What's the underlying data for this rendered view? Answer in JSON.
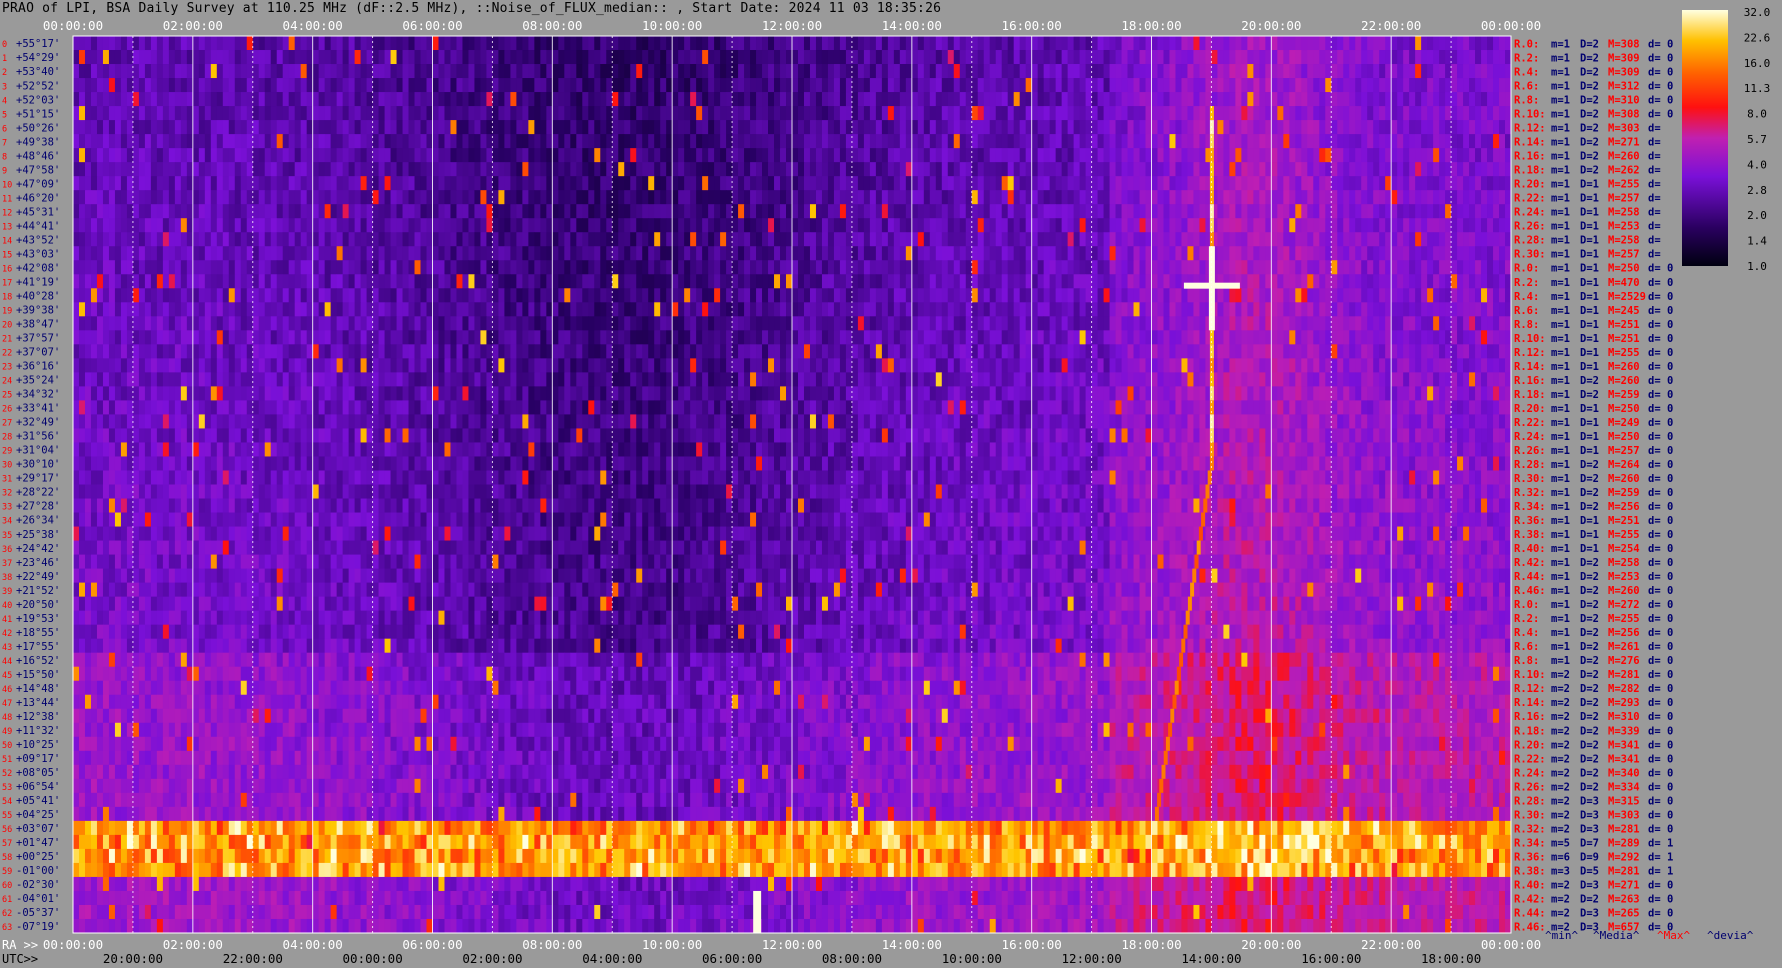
{
  "title": "PRAO of LPI, BSA Daily Survey at 110.25 MHz (dF::2.5 MHz), ::Noise_of_FLUX_median:: , Start Date: 2024 11 03 18:35:26",
  "chart_data": {
    "type": "heatmap",
    "top_time_labels": [
      "00:00:00",
      "02:00:00",
      "04:00:00",
      "06:00:00",
      "08:00:00",
      "10:00:00",
      "12:00:00",
      "14:00:00",
      "16:00:00",
      "18:00:00",
      "20:00:00",
      "22:00:00",
      "00:00:00"
    ],
    "bottom_ra_labels": [
      "00:00:00",
      "02:00:00",
      "04:00:00",
      "06:00:00",
      "08:00:00",
      "10:00:00",
      "12:00:00",
      "14:00:00",
      "16:00:00",
      "18:00:00",
      "20:00:00",
      "22:00:00",
      "00:00:00"
    ],
    "bottom_utc_labels": [
      "20:00:00",
      "22:00:00",
      "00:00:00",
      "02:00:00",
      "04:00:00",
      "06:00:00",
      "08:00:00",
      "10:00:00",
      "12:00:00",
      "14:00:00",
      "16:00:00",
      "18:00:00"
    ],
    "ra_prefix": "RA >>",
    "utc_prefix": "UTC>>",
    "colorbar_ticks": [
      "32.0",
      "22.6",
      "16.0",
      "11.3",
      "8.0",
      "5.7",
      "4.0",
      "2.8",
      "2.0",
      "1.4",
      "1.0"
    ],
    "legend_footer": [
      "^min^",
      "^Media^",
      "^Max^",
      "^devia^"
    ],
    "rows": [
      {
        "n": "0",
        "dec": "+55°17'",
        "r": "R.0:",
        "m": "1",
        "D": "2",
        "M": "308",
        "d": "0"
      },
      {
        "n": "1",
        "dec": "+54°29'",
        "r": "R.2:",
        "m": "1",
        "D": "2",
        "M": "309",
        "d": "0"
      },
      {
        "n": "2",
        "dec": "+53°40'",
        "r": "R.4:",
        "m": "1",
        "D": "2",
        "M": "309",
        "d": "0"
      },
      {
        "n": "3",
        "dec": "+52°52'",
        "r": "R.6:",
        "m": "1",
        "D": "2",
        "M": "312",
        "d": "0"
      },
      {
        "n": "4",
        "dec": "+52°03'",
        "r": "R.8:",
        "m": "1",
        "D": "2",
        "M": "310",
        "d": "0"
      },
      {
        "n": "5",
        "dec": "+51°15'",
        "r": "R.10:",
        "m": "1",
        "D": "2",
        "M": "308",
        "d": "0"
      },
      {
        "n": "6",
        "dec": "+50°26'",
        "r": "R.12:",
        "m": "1",
        "D": "2",
        "M": "303",
        "d": ""
      },
      {
        "n": "7",
        "dec": "+49°38'",
        "r": "R.14:",
        "m": "1",
        "D": "2",
        "M": "271",
        "d": ""
      },
      {
        "n": "8",
        "dec": "+48°46'",
        "r": "R.16:",
        "m": "1",
        "D": "2",
        "M": "260",
        "d": ""
      },
      {
        "n": "9",
        "dec": "+47°58'",
        "r": "R.18:",
        "m": "1",
        "D": "2",
        "M": "262",
        "d": ""
      },
      {
        "n": "10",
        "dec": "+47°09'",
        "r": "R.20:",
        "m": "1",
        "D": "1",
        "M": "255",
        "d": ""
      },
      {
        "n": "11",
        "dec": "+46°20'",
        "r": "R.22:",
        "m": "1",
        "D": "1",
        "M": "257",
        "d": ""
      },
      {
        "n": "12",
        "dec": "+45°31'",
        "r": "R.24:",
        "m": "1",
        "D": "1",
        "M": "258",
        "d": ""
      },
      {
        "n": "13",
        "dec": "+44°41'",
        "r": "R.26:",
        "m": "1",
        "D": "1",
        "M": "253",
        "d": ""
      },
      {
        "n": "14",
        "dec": "+43°52'",
        "r": "R.28:",
        "m": "1",
        "D": "1",
        "M": "258",
        "d": ""
      },
      {
        "n": "15",
        "dec": "+43°03'",
        "r": "R.30:",
        "m": "1",
        "D": "1",
        "M": "257",
        "d": ""
      },
      {
        "n": "16",
        "dec": "+42°08'",
        "r": "R.0:",
        "m": "1",
        "D": "1",
        "M": "250",
        "d": "0"
      },
      {
        "n": "17",
        "dec": "+41°19'",
        "r": "R.2:",
        "m": "1",
        "D": "1",
        "M": "470",
        "d": "0"
      },
      {
        "n": "18",
        "dec": "+40°28'",
        "r": "R.4:",
        "m": "1",
        "D": "1",
        "M": "2529",
        "d": "0"
      },
      {
        "n": "19",
        "dec": "+39°38'",
        "r": "R.6:",
        "m": "1",
        "D": "1",
        "M": "245",
        "d": "0"
      },
      {
        "n": "20",
        "dec": "+38°47'",
        "r": "R.8:",
        "m": "1",
        "D": "1",
        "M": "251",
        "d": "0"
      },
      {
        "n": "21",
        "dec": "+37°57'",
        "r": "R.10:",
        "m": "1",
        "D": "1",
        "M": "251",
        "d": "0"
      },
      {
        "n": "22",
        "dec": "+37°07'",
        "r": "R.12:",
        "m": "1",
        "D": "1",
        "M": "255",
        "d": "0"
      },
      {
        "n": "23",
        "dec": "+36°16'",
        "r": "R.14:",
        "m": "1",
        "D": "1",
        "M": "260",
        "d": "0"
      },
      {
        "n": "24",
        "dec": "+35°24'",
        "r": "R.16:",
        "m": "1",
        "D": "2",
        "M": "260",
        "d": "0"
      },
      {
        "n": "25",
        "dec": "+34°32'",
        "r": "R.18:",
        "m": "1",
        "D": "2",
        "M": "259",
        "d": "0"
      },
      {
        "n": "26",
        "dec": "+33°41'",
        "r": "R.20:",
        "m": "1",
        "D": "1",
        "M": "250",
        "d": "0"
      },
      {
        "n": "27",
        "dec": "+32°49'",
        "r": "R.22:",
        "m": "1",
        "D": "1",
        "M": "249",
        "d": "0"
      },
      {
        "n": "28",
        "dec": "+31°56'",
        "r": "R.24:",
        "m": "1",
        "D": "1",
        "M": "250",
        "d": "0"
      },
      {
        "n": "29",
        "dec": "+31°04'",
        "r": "R.26:",
        "m": "1",
        "D": "1",
        "M": "257",
        "d": "0"
      },
      {
        "n": "30",
        "dec": "+30°10'",
        "r": "R.28:",
        "m": "1",
        "D": "2",
        "M": "264",
        "d": "0"
      },
      {
        "n": "31",
        "dec": "+29°17'",
        "r": "R.30:",
        "m": "1",
        "D": "2",
        "M": "260",
        "d": "0"
      },
      {
        "n": "32",
        "dec": "+28°22'",
        "r": "R.32:",
        "m": "1",
        "D": "2",
        "M": "259",
        "d": "0"
      },
      {
        "n": "33",
        "dec": "+27°28'",
        "r": "R.34:",
        "m": "1",
        "D": "2",
        "M": "256",
        "d": "0"
      },
      {
        "n": "34",
        "dec": "+26°34'",
        "r": "R.36:",
        "m": "1",
        "D": "1",
        "M": "251",
        "d": "0"
      },
      {
        "n": "35",
        "dec": "+25°38'",
        "r": "R.38:",
        "m": "1",
        "D": "1",
        "M": "255",
        "d": "0"
      },
      {
        "n": "36",
        "dec": "+24°42'",
        "r": "R.40:",
        "m": "1",
        "D": "1",
        "M": "254",
        "d": "0"
      },
      {
        "n": "37",
        "dec": "+23°46'",
        "r": "R.42:",
        "m": "1",
        "D": "2",
        "M": "258",
        "d": "0"
      },
      {
        "n": "38",
        "dec": "+22°49'",
        "r": "R.44:",
        "m": "1",
        "D": "2",
        "M": "253",
        "d": "0"
      },
      {
        "n": "39",
        "dec": "+21°52'",
        "r": "R.46:",
        "m": "1",
        "D": "2",
        "M": "260",
        "d": "0"
      },
      {
        "n": "40",
        "dec": "+20°50'",
        "r": "R.0:",
        "m": "1",
        "D": "2",
        "M": "272",
        "d": "0"
      },
      {
        "n": "41",
        "dec": "+19°53'",
        "r": "R.2:",
        "m": "1",
        "D": "2",
        "M": "255",
        "d": "0"
      },
      {
        "n": "42",
        "dec": "+18°55'",
        "r": "R.4:",
        "m": "1",
        "D": "2",
        "M": "256",
        "d": "0"
      },
      {
        "n": "43",
        "dec": "+17°55'",
        "r": "R.6:",
        "m": "1",
        "D": "2",
        "M": "261",
        "d": "0"
      },
      {
        "n": "44",
        "dec": "+16°52'",
        "r": "R.8:",
        "m": "1",
        "D": "2",
        "M": "276",
        "d": "0"
      },
      {
        "n": "45",
        "dec": "+15°50'",
        "r": "R.10:",
        "m": "2",
        "D": "2",
        "M": "281",
        "d": "0"
      },
      {
        "n": "46",
        "dec": "+14°48'",
        "r": "R.12:",
        "m": "2",
        "D": "2",
        "M": "282",
        "d": "0"
      },
      {
        "n": "47",
        "dec": "+13°44'",
        "r": "R.14:",
        "m": "2",
        "D": "2",
        "M": "293",
        "d": "0"
      },
      {
        "n": "48",
        "dec": "+12°38'",
        "r": "R.16:",
        "m": "2",
        "D": "2",
        "M": "310",
        "d": "0"
      },
      {
        "n": "49",
        "dec": "+11°32'",
        "r": "R.18:",
        "m": "2",
        "D": "2",
        "M": "339",
        "d": "0"
      },
      {
        "n": "50",
        "dec": "+10°25'",
        "r": "R.20:",
        "m": "2",
        "D": "2",
        "M": "341",
        "d": "0"
      },
      {
        "n": "51",
        "dec": "+09°17'",
        "r": "R.22:",
        "m": "2",
        "D": "2",
        "M": "341",
        "d": "0"
      },
      {
        "n": "52",
        "dec": "+08°05'",
        "r": "R.24:",
        "m": "2",
        "D": "2",
        "M": "340",
        "d": "0"
      },
      {
        "n": "53",
        "dec": "+06°54'",
        "r": "R.26:",
        "m": "2",
        "D": "2",
        "M": "334",
        "d": "0"
      },
      {
        "n": "54",
        "dec": "+05°41'",
        "r": "R.28:",
        "m": "2",
        "D": "3",
        "M": "315",
        "d": "0"
      },
      {
        "n": "55",
        "dec": "+04°25'",
        "r": "R.30:",
        "m": "2",
        "D": "3",
        "M": "303",
        "d": "0"
      },
      {
        "n": "56",
        "dec": "+03°07'",
        "r": "R.32:",
        "m": "2",
        "D": "3",
        "M": "281",
        "d": "0"
      },
      {
        "n": "57",
        "dec": "+01°47'",
        "r": "R.34:",
        "m": "5",
        "D": "7",
        "M": "289",
        "d": "1"
      },
      {
        "n": "58",
        "dec": "+00°25'",
        "r": "R.36:",
        "m": "6",
        "D": "9",
        "M": "292",
        "d": "1"
      },
      {
        "n": "59",
        "dec": "-01°00'",
        "r": "R.38:",
        "m": "3",
        "D": "5",
        "M": "281",
        "d": "1"
      },
      {
        "n": "60",
        "dec": "-02°30'",
        "r": "R.40:",
        "m": "2",
        "D": "3",
        "M": "271",
        "d": "0"
      },
      {
        "n": "61",
        "dec": "-04°01'",
        "r": "R.42:",
        "m": "2",
        "D": "2",
        "M": "263",
        "d": "0"
      },
      {
        "n": "62",
        "dec": "-05°37'",
        "r": "R.44:",
        "m": "2",
        "D": "3",
        "M": "265",
        "d": "0"
      },
      {
        "n": "63",
        "dec": "-07°19'",
        "r": "R.46:",
        "m": "2",
        "D": "3",
        "M": "657",
        "d": "0"
      }
    ],
    "colors": {
      "low": "#0a0020",
      "mid": "#7a10d8",
      "high": "#ff2020",
      "peak": "#ffffa0",
      "text_blue": "#0000a0",
      "text_red": "#ff0000",
      "background": "#9a9a9a"
    }
  }
}
